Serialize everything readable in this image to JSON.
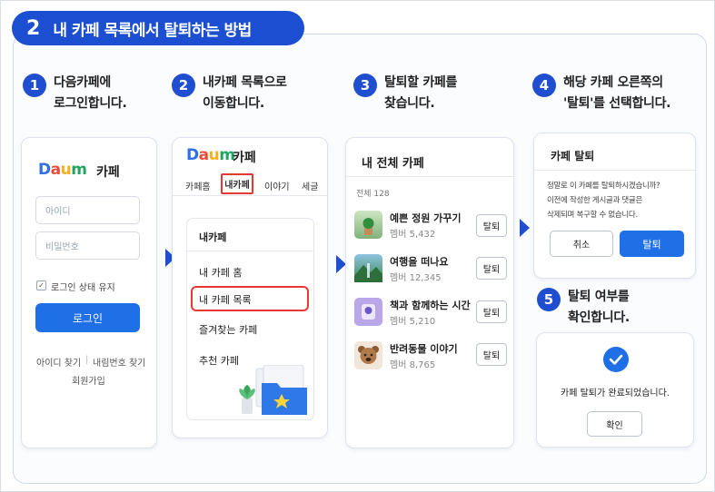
{
  "header": {
    "step_number": "2",
    "title": "내 카페 목록에서 탈퇴하는 방법"
  },
  "steps": [
    {
      "number": "1",
      "line1": "다음카페에",
      "line2": "로그인합니다."
    },
    {
      "number": "2",
      "line1": "내카페 목록으로",
      "line2": "이동합니다."
    },
    {
      "number": "3",
      "line1": "탈퇴할 카페를",
      "line2": "찾습니다."
    },
    {
      "number": "4",
      "line1": "해당 카페 오른쪽의",
      "line2": "'탈퇴'를 선택합니다."
    },
    {
      "number": "5",
      "line1": "탈퇴 여부를",
      "line2": "확인합니다."
    }
  ],
  "login": {
    "logo": {
      "d": "D",
      "a": "a",
      "u": "u",
      "m": "m"
    },
    "cafe_label": "카페",
    "id_placeholder": "아이디",
    "pw_placeholder": "비밀번호",
    "keep_login": "로그인 상태 유지",
    "login_button": "로그인",
    "find_id": "아이디 찾기",
    "divider": "|",
    "find_pw": "내림번호 찾기",
    "signup": "회원가입"
  },
  "mycafe": {
    "logo": {
      "d": "D",
      "a": "a",
      "u": "u",
      "m": "m"
    },
    "cafe_label": "카페",
    "tabs": [
      "카페홈",
      "내카페",
      "이야기",
      "세글"
    ],
    "menu_title": "내카페",
    "menu_items": [
      "내 카페 홈",
      "내 카페 목록",
      "즐겨찾는 카페",
      "추천 카페"
    ]
  },
  "cafelist": {
    "title": "내 전체 카페",
    "count": "전체 128",
    "leave_label": "탈퇴",
    "items": [
      {
        "name": "예쁜 정원 가꾸기",
        "members": "멤버 5,432"
      },
      {
        "name": "여행을 떠나요",
        "members": "멤버 12,345"
      },
      {
        "name": "책과 함께하는 시간",
        "members": "멤버 5,210"
      },
      {
        "name": "반려동물 이야기",
        "members": "멤버 8,765"
      }
    ]
  },
  "dialog": {
    "title": "카페 탈퇴",
    "message_line1": "정말로 이 카페를 탈퇴하시겠습니까?",
    "message_line2": "이전에 작성한 게시글과 댓글은",
    "message_line3": "삭제되며 복구할 수 없습니다.",
    "cancel": "취소",
    "confirm": "탈퇴"
  },
  "result": {
    "message": "카페 탈퇴가 완료되었습니다.",
    "ok": "확인"
  },
  "colors": {
    "accent": "#1f4fd0",
    "button": "#1f6fe6",
    "highlight": "#e53935"
  }
}
